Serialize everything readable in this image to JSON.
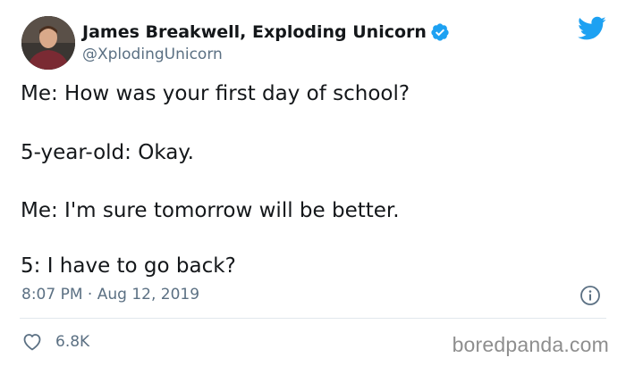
{
  "author": {
    "name": "James Breakwell, Exploding Unicorn",
    "handle": "@XplodingUnicorn",
    "verified": true,
    "avatar_icon": "profile-photo"
  },
  "tweet": {
    "lines": [
      "Me: How was your first day of school?",
      "5-year-old: Okay.",
      "Me: I'm sure tomorrow will be better.",
      "5: I have to go back?"
    ],
    "time": "8:07 PM",
    "separator": "·",
    "date": "Aug 12, 2019"
  },
  "engagement": {
    "likes": "6.8K"
  },
  "watermark": "boredpanda.com",
  "icons": {
    "brand": "twitter-bird-icon",
    "verified": "verified-badge-icon",
    "info": "info-icon",
    "like": "heart-icon"
  },
  "colors": {
    "twitter_blue": "#1da1f2",
    "text_primary": "#14171a",
    "text_secondary": "#5b7083",
    "divider": "#e1e8ed",
    "watermark": "#8e8e8e"
  }
}
